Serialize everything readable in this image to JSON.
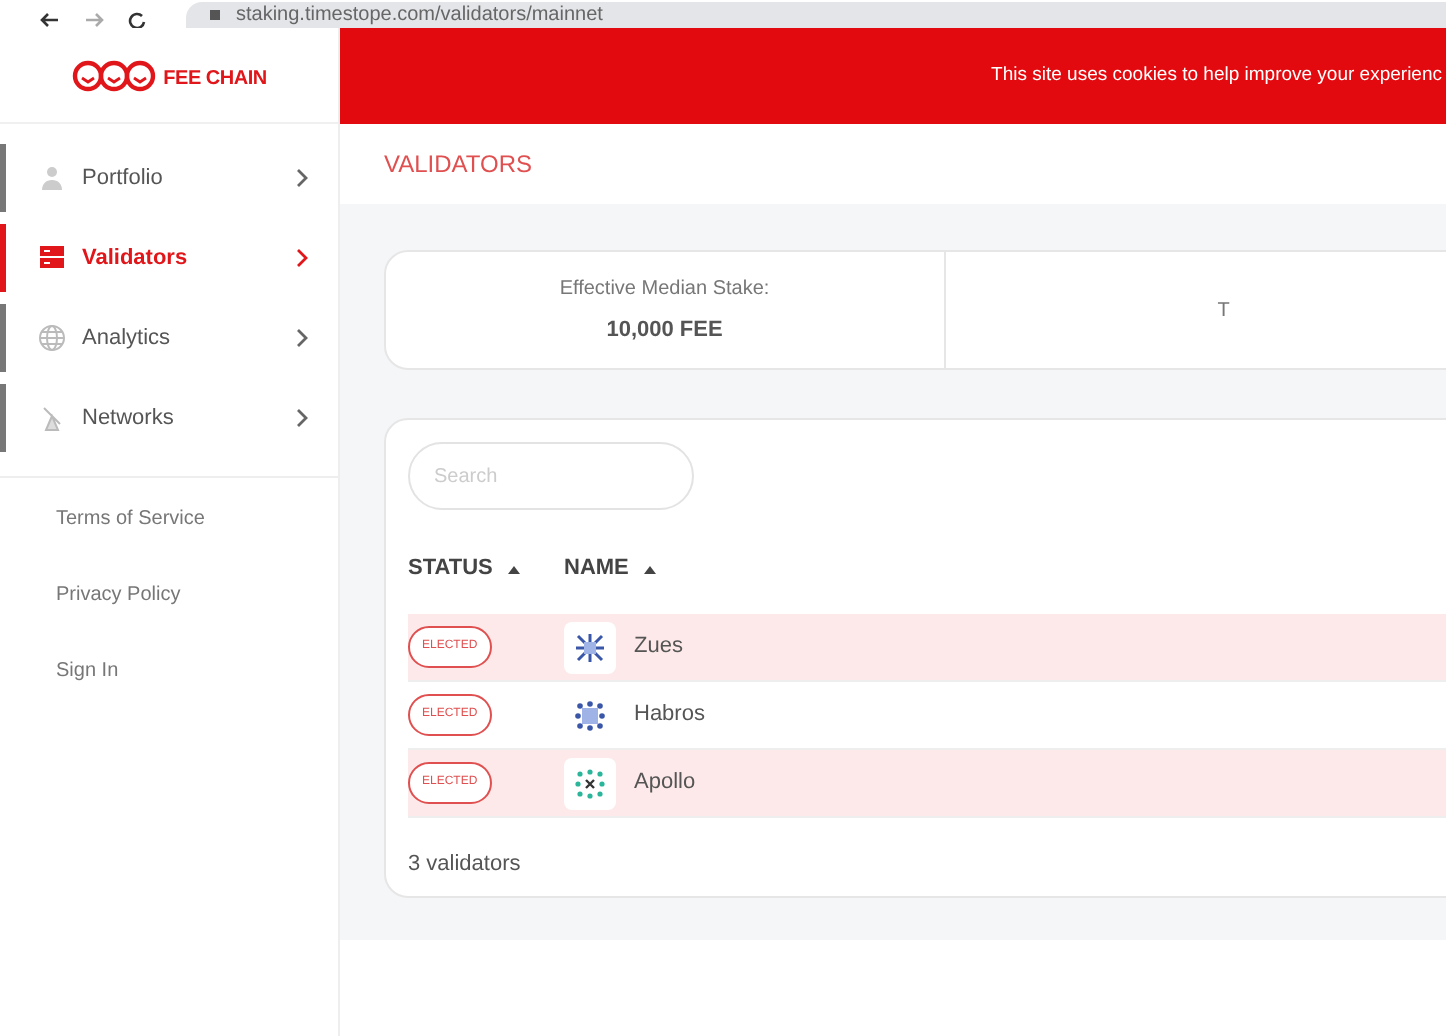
{
  "browser": {
    "url": "staking.timestope.com/validators/mainnet"
  },
  "logo": {
    "text": "FEE CHAIN"
  },
  "banner": {
    "text": "This site uses cookies to help improve your experienc"
  },
  "sidebar": {
    "items": [
      {
        "label": "Portfolio",
        "selected": false
      },
      {
        "label": "Validators",
        "selected": true
      },
      {
        "label": "Analytics",
        "selected": false
      },
      {
        "label": "Networks",
        "selected": false
      }
    ],
    "links": [
      "Terms of Service",
      "Privacy Policy",
      "Sign In"
    ]
  },
  "page_title": "VALIDATORS",
  "stats": [
    {
      "label": "Effective Median Stake:",
      "value": "10,000 FEE"
    },
    {
      "label": "T"
    }
  ],
  "search": {
    "placeholder": "Search"
  },
  "table": {
    "columns": [
      "STATUS",
      "NAME"
    ],
    "rows": [
      {
        "status": "ELECTED",
        "name": "Zues",
        "highlighted": true
      },
      {
        "status": "ELECTED",
        "name": "Habros",
        "highlighted": false
      },
      {
        "status": "ELECTED",
        "name": "Apollo",
        "highlighted": true
      }
    ],
    "footer": "3 validators"
  }
}
